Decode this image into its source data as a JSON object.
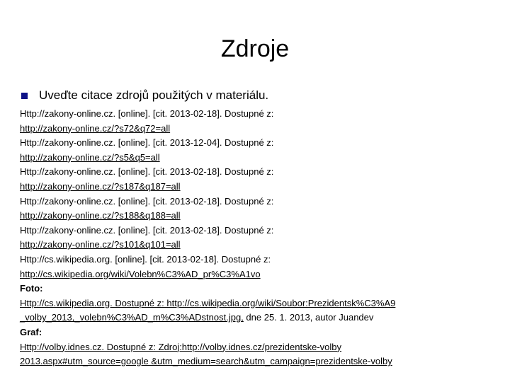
{
  "slide": {
    "title": "Zdroje",
    "bullet": "Uveďte citace zdrojů použitých v materiálu."
  },
  "refs": {
    "r1_text": "Http://zakony-online.cz. [online]. [cit. 2013-02-18]. Dostupné z:",
    "r1_link": "http://zakony-online.cz/?s72&q72=all",
    "r2_text": "Http://zakony-online.cz. [online]. [cit. 2013-12-04]. Dostupné z:",
    "r2_link": "http://zakony-online.cz/?s5&q5=all",
    "r3_text": "Http://zakony-online.cz. [online]. [cit. 2013-02-18]. Dostupné z:",
    "r3_link": "http://zakony-online.cz/?s187&q187=all",
    "r4_text": "Http://zakony-online.cz. [online]. [cit. 2013-02-18]. Dostupné z:",
    "r4_link": "http://zakony-online.cz/?s188&q188=all",
    "r5_text": "Http://zakony-online.cz. [online]. [cit. 2013-02-18]. Dostupné z:",
    "r5_link": "http://zakony-online.cz/?s101&q101=all",
    "r6_text": "Http://cs.wikipedia.org. [online]. [cit. 2013-02-18]. Dostupné z:",
    "r6_link": "http://cs.wikipedia.org/wiki/Volebn%C3%AD_pr%C3%A1vo",
    "foto_label": "Foto:",
    "foto_link1": "Http://cs.wikipedia.org. Dostupné z: http://cs.wikipedia.org/wiki/Soubor:Prezidentsk%C3%A9",
    "foto_link2": "_volby_2013,_volebn%C3%AD_m%C3%ADstnost.jpg,",
    "foto_suffix": " dne 25. 1. 2013, autor Juandev",
    "graf_label": "Graf:",
    "graf_link1": "Http://volby.idnes.cz. Dostupné z: Zdroj:http://volby.idnes.cz/prezidentske-volby",
    "graf_link2": "2013.aspx#utm_source=google &utm_medium=search&utm_campaign=prezidentske-volby"
  },
  "colors": {
    "bullet": "#0e1287",
    "background": "#ffffff",
    "text": "#000000"
  }
}
